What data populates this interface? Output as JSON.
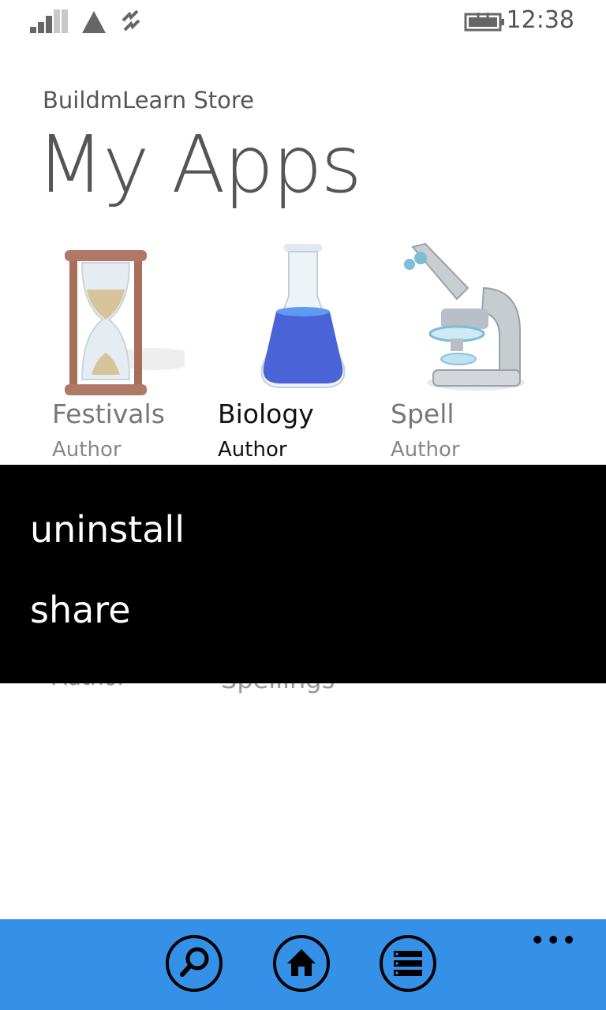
{
  "status": {
    "time": "12:38"
  },
  "header": {
    "app_name": "BuildmLearn Store",
    "title": "My Apps"
  },
  "apps": [
    {
      "name": "Festivals",
      "author": "Author",
      "icon": "hourglass-icon"
    },
    {
      "name": "Biology",
      "author": "Author",
      "icon": "flask-icon"
    },
    {
      "name": "Spell",
      "author": "Author",
      "icon": "microscope-icon"
    }
  ],
  "context_menu": {
    "items": [
      "uninstall",
      "share"
    ]
  },
  "behind_menu": {
    "partial_author": "Author",
    "partial_name": "Spellings"
  },
  "app_bar": {
    "buttons": [
      "search-icon",
      "home-icon",
      "list-icon"
    ],
    "more": "•••",
    "color": "#3590e8"
  }
}
